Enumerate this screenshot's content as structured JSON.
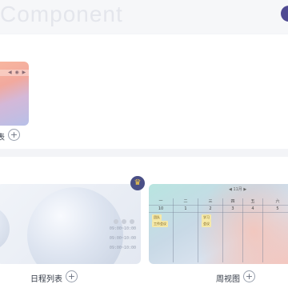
{
  "header": {
    "title": "Component"
  },
  "sections": [
    {
      "items": [
        {
          "caption": "表",
          "has_add": true
        }
      ]
    },
    {
      "items": [
        {
          "caption": "日程列表",
          "has_add": true,
          "premium_icon": "crown-icon",
          "thumbnail": {
            "times": [
              "09:00~10:00",
              "09:00~10:00",
              "09:00~10:00"
            ]
          }
        },
        {
          "caption": "周视图",
          "has_add": true,
          "thumbnail": {
            "month": "11月",
            "day_labels": [
              "一",
              "二",
              "三",
              "四",
              "五",
              "六"
            ],
            "dates": [
              "10",
              "1",
              "2",
              "3",
              "4",
              "5"
            ],
            "tags": [
              "团队",
              "工作会议",
              "学习",
              "会议"
            ]
          }
        }
      ]
    }
  ],
  "colors": {
    "accent": "#4f4a92",
    "crown": "#f6c949"
  }
}
